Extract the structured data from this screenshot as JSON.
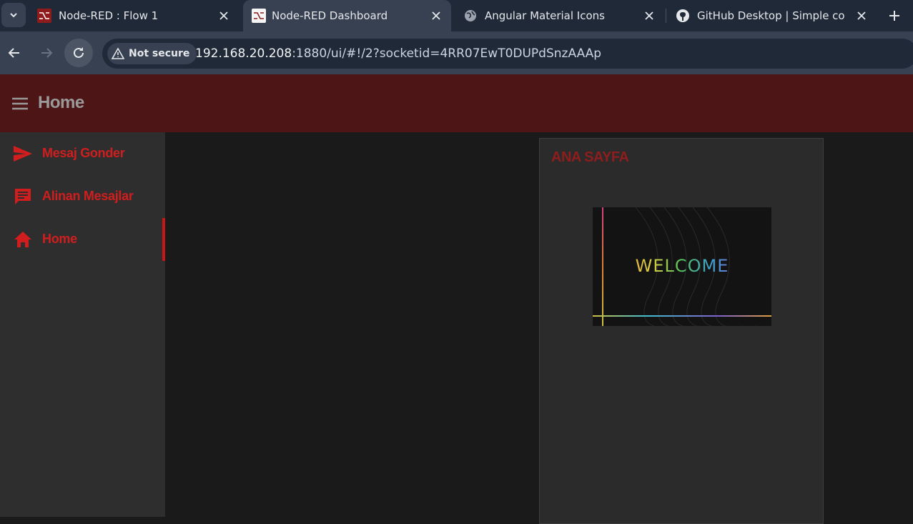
{
  "browser": {
    "tabs": [
      {
        "title": "Node-RED : Flow 1",
        "active": false,
        "favicon": "node-red-icon"
      },
      {
        "title": "Node-RED Dashboard",
        "active": true,
        "favicon": "node-red-icon"
      },
      {
        "title": "Angular Material Icons",
        "active": false,
        "favicon": "globe-icon"
      },
      {
        "title": "GitHub Desktop | Simple collab",
        "active": false,
        "favicon": "github-icon"
      }
    ],
    "security_label": "Not secure",
    "url_host": "192.168.20.208",
    "url_rest": ":1880/ui/#!/2?socketid=4RR07EwT0DUPdSnzAAAp"
  },
  "dashboard": {
    "title": "Home",
    "nav": [
      {
        "label": "Mesaj Gonder",
        "icon": "send-icon",
        "active": false
      },
      {
        "label": "Alinan Mesajlar",
        "icon": "message-icon",
        "active": false
      },
      {
        "label": "Home",
        "icon": "home-icon",
        "active": true
      }
    ],
    "group": {
      "title": "ANA SAYFA",
      "image_text": "WELCOME"
    }
  },
  "colors": {
    "header_bg": "#4d1515",
    "accent_red": "#d01e1e",
    "sidebar_bg": "#2e2e2e",
    "main_bg": "#1a1a1a",
    "card_bg": "#2b2b2b"
  }
}
